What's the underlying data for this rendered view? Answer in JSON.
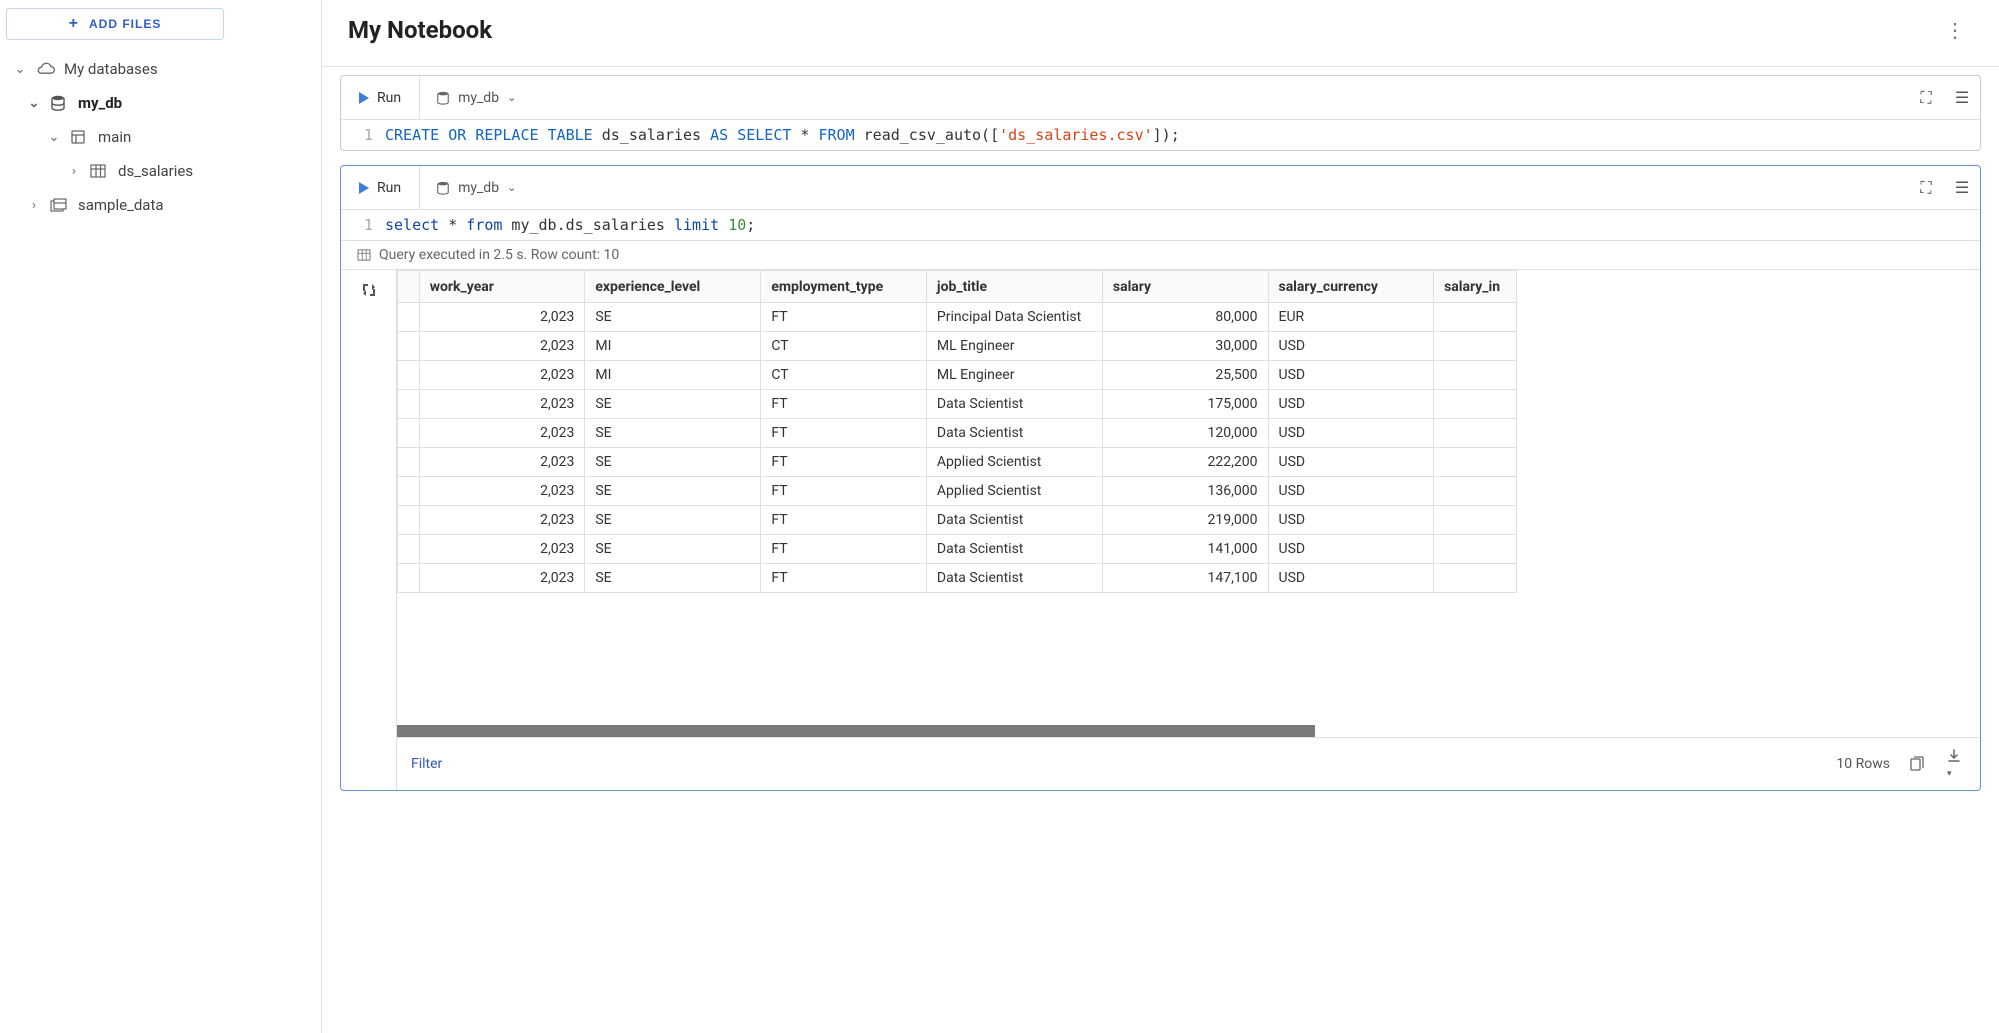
{
  "sidebar": {
    "add_files": "ADD FILES",
    "root": "My databases",
    "my_db": "my_db",
    "main": "main",
    "ds_salaries": "ds_salaries",
    "sample_data": "sample_data"
  },
  "header": {
    "title": "My Notebook"
  },
  "cell1": {
    "run": "Run",
    "db": "my_db",
    "line_no": "1",
    "sql_plain": "CREATE OR REPLACE TABLE ds_salaries AS SELECT * FROM read_csv_auto(['ds_salaries.csv']);"
  },
  "cell2": {
    "run": "Run",
    "db": "my_db",
    "line_no": "1",
    "sql_plain": "select * from my_db.ds_salaries limit 10;",
    "status": "Query executed in 2.5 s. Row count: 10",
    "columns": [
      "work_year",
      "experience_level",
      "employment_type",
      "job_title",
      "salary",
      "salary_currency",
      "salary_in"
    ],
    "rows": [
      {
        "work_year": "2,023",
        "experience_level": "SE",
        "employment_type": "FT",
        "job_title": "Principal Data Scientist",
        "salary": "80,000",
        "salary_currency": "EUR"
      },
      {
        "work_year": "2,023",
        "experience_level": "MI",
        "employment_type": "CT",
        "job_title": "ML Engineer",
        "salary": "30,000",
        "salary_currency": "USD"
      },
      {
        "work_year": "2,023",
        "experience_level": "MI",
        "employment_type": "CT",
        "job_title": "ML Engineer",
        "salary": "25,500",
        "salary_currency": "USD"
      },
      {
        "work_year": "2,023",
        "experience_level": "SE",
        "employment_type": "FT",
        "job_title": "Data Scientist",
        "salary": "175,000",
        "salary_currency": "USD"
      },
      {
        "work_year": "2,023",
        "experience_level": "SE",
        "employment_type": "FT",
        "job_title": "Data Scientist",
        "salary": "120,000",
        "salary_currency": "USD"
      },
      {
        "work_year": "2,023",
        "experience_level": "SE",
        "employment_type": "FT",
        "job_title": "Applied Scientist",
        "salary": "222,200",
        "salary_currency": "USD"
      },
      {
        "work_year": "2,023",
        "experience_level": "SE",
        "employment_type": "FT",
        "job_title": "Applied Scientist",
        "salary": "136,000",
        "salary_currency": "USD"
      },
      {
        "work_year": "2,023",
        "experience_level": "SE",
        "employment_type": "FT",
        "job_title": "Data Scientist",
        "salary": "219,000",
        "salary_currency": "USD"
      },
      {
        "work_year": "2,023",
        "experience_level": "SE",
        "employment_type": "FT",
        "job_title": "Data Scientist",
        "salary": "141,000",
        "salary_currency": "USD"
      },
      {
        "work_year": "2,023",
        "experience_level": "SE",
        "employment_type": "FT",
        "job_title": "Data Scientist",
        "salary": "147,100",
        "salary_currency": "USD"
      }
    ],
    "footer": {
      "filter": "Filter",
      "rowcount": "10 Rows"
    }
  }
}
